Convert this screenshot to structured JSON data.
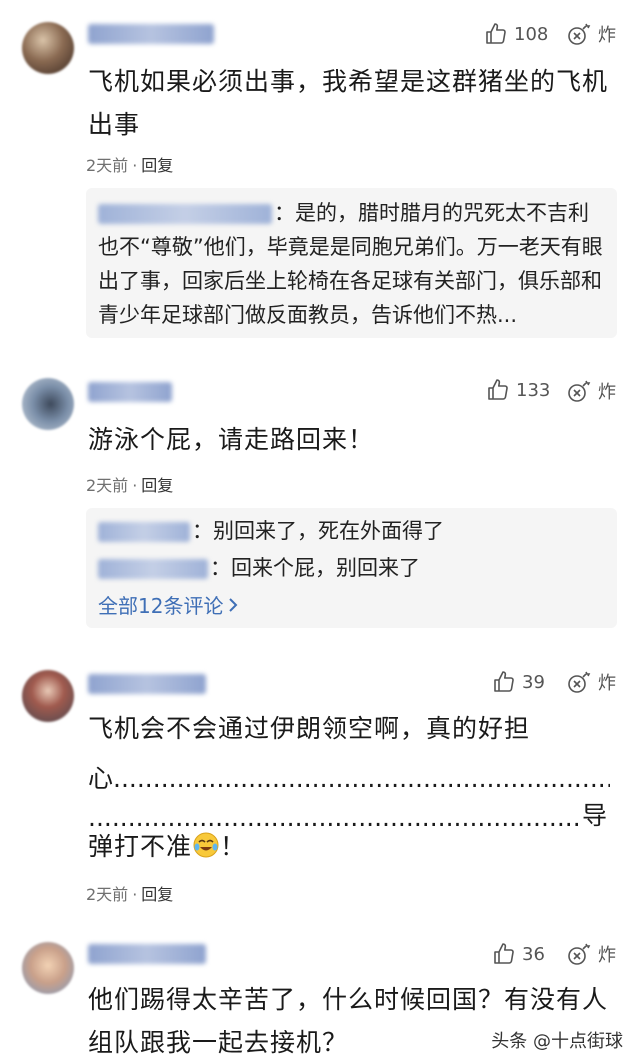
{
  "comments": [
    {
      "likes": "108",
      "bomb_label": "炸",
      "text": "飞机如果必须出事，我希望是这群猪坐的飞机出事",
      "time": "2天前",
      "sep": "·",
      "reply": "回复",
      "replies": [
        {
          "text": "：是的，腊时腊月的咒死太不吉利也不“尊敬”他们，毕竟是是同胞兄弟们。万一老天有眼出了事，回家后坐上轮椅在各足球有关部门，俱乐部和青少年足球部门做反面教员，告诉他们不热..."
        }
      ]
    },
    {
      "likes": "133",
      "bomb_label": "炸",
      "text": "游泳个屁，请走路回来！",
      "time": "2天前",
      "sep": "·",
      "reply": "回复",
      "replies": [
        {
          "text": "：别回来了，死在外面得了"
        },
        {
          "text": "：回来个屁，别回来了"
        }
      ],
      "see_all": "全部12条评论"
    },
    {
      "likes": "39",
      "bomb_label": "炸",
      "text_line1": "飞机会不会通过伊朗领空啊，真的好担",
      "text_line2": "心",
      "text_line3_end": "导",
      "text_line4": "弹打不准",
      "text_line4_end": "！",
      "time": "2天前",
      "sep": "·",
      "reply": "回复"
    },
    {
      "likes": "36",
      "bomb_label": "炸",
      "text": "他们踢得太辛苦了，什么时候回国？有没有人组队跟我一起去接机？"
    }
  ],
  "watermark": "头条 @十点街球"
}
